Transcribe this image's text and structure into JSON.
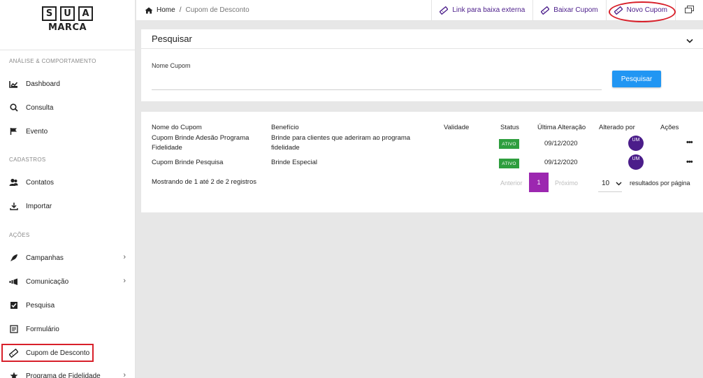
{
  "logo": {
    "letters": [
      "S",
      "U",
      "A"
    ],
    "sub": "MARCA"
  },
  "sidebar": {
    "sections": {
      "analise": "ANÁLISE & COMPORTAMENTO",
      "cadastros": "CADASTROS",
      "acoes": "AÇÕES"
    },
    "items": [
      {
        "label": "Dashboard",
        "icon": "chart-icon"
      },
      {
        "label": "Consulta",
        "icon": "search-icon"
      },
      {
        "label": "Evento",
        "icon": "flag-icon"
      },
      {
        "label": "Contatos",
        "icon": "contacts-icon"
      },
      {
        "label": "Importar",
        "icon": "import-icon"
      },
      {
        "label": "Campanhas",
        "icon": "rocket-icon"
      },
      {
        "label": "Comunicação",
        "icon": "megaphone-icon"
      },
      {
        "label": "Pesquisa",
        "icon": "checkbox-icon"
      },
      {
        "label": "Formulário",
        "icon": "form-icon"
      },
      {
        "label": "Cupom de Desconto",
        "icon": "ticket-icon"
      },
      {
        "label": "Programa de Fidelidade",
        "icon": "star-icon"
      }
    ]
  },
  "breadcrumb": {
    "home": "Home",
    "separator": "/",
    "current": "Cupom de Desconto"
  },
  "topbar": {
    "link_externo": "Link para baixa externa",
    "baixar": "Baixar Cupom",
    "novo": "Novo Cupom"
  },
  "search": {
    "title": "Pesquisar",
    "field_label": "Nome Cupom",
    "field_value": "",
    "button": "Pesquisar"
  },
  "table": {
    "headers": {
      "nome": "Nome do Cupom",
      "beneficio": "Benefício",
      "validade": "Validade",
      "status": "Status",
      "ultima": "Última Alteração",
      "alterado": "Alterado por",
      "acoes": "Ações"
    },
    "rows": [
      {
        "nome1": "Cupom Brinde Adesão Programa",
        "nome2": "Fidelidade",
        "beneficio1": "Brinde para clientes que aderiram ao programa",
        "beneficio2": "fidelidade",
        "validade": "",
        "status": "ATIVO",
        "ultima": "09/12/2020",
        "alterado": "UM",
        "acoes": "•••"
      },
      {
        "nome1": "Cupom Brinde Pesquisa",
        "nome2": "",
        "beneficio1": "Brinde Especial",
        "beneficio2": "",
        "validade": "",
        "status": "ATIVO",
        "ultima": "09/12/2020",
        "alterado": "UM",
        "acoes": "•••"
      }
    ],
    "summary": "Mostrando de 1 até 2 de 2 registros"
  },
  "pagination": {
    "prev": "Anterior",
    "current": "1",
    "next": "Próximo",
    "per_page": "10",
    "per_page_label": "resultados por página"
  },
  "colors": {
    "accent_purple": "#4b1d8a",
    "status_green": "#2e9e3e",
    "button_blue": "#2196f3",
    "page_active": "#9c27b0",
    "highlight_red": "#d8202a"
  }
}
